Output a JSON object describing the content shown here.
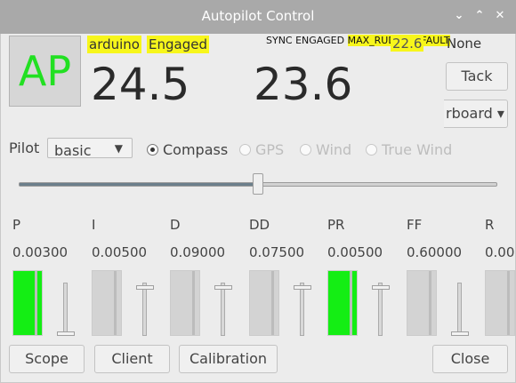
{
  "window": {
    "title": "Autopilot Control",
    "controls": [
      "⌄",
      "⌃",
      "✕"
    ]
  },
  "ap_button": {
    "label": "AP",
    "color": "#22e022"
  },
  "status": {
    "servo": "arduino",
    "mode_state": "Engaged",
    "flags_plain": "SYNC ENGAGED",
    "flags_fault": "MAX_RUDDER_FAULT",
    "rudder_partial": "22.6",
    "rudder_none": "None"
  },
  "heading": {
    "actual": "24.5",
    "command": "23.6"
  },
  "buttons": {
    "tack": "Tack",
    "tack_direction": "rboard ▾",
    "scope": "Scope",
    "client": "Client",
    "calibration": "Calibration",
    "close": "Close"
  },
  "pilot": {
    "label": "Pilot",
    "selected": "basic",
    "modes": [
      {
        "label": "Compass",
        "checked": true,
        "enabled": true
      },
      {
        "label": "GPS",
        "checked": false,
        "enabled": false
      },
      {
        "label": "Wind",
        "checked": false,
        "enabled": false
      },
      {
        "label": "True Wind",
        "checked": false,
        "enabled": false
      }
    ]
  },
  "command_slider": {
    "fraction": 0.5
  },
  "gains": [
    {
      "name": "P",
      "value": "0.00300",
      "level": 1.0,
      "slider": 0.02
    },
    {
      "name": "I",
      "value": "0.00500",
      "level": 0.0,
      "slider": 0.95
    },
    {
      "name": "D",
      "value": "0.09000",
      "level": 0.0,
      "slider": 0.95
    },
    {
      "name": "DD",
      "value": "0.07500",
      "level": 0.0,
      "slider": 0.95
    },
    {
      "name": "PR",
      "value": "0.00500",
      "level": 1.0,
      "slider": 0.95
    },
    {
      "name": "FF",
      "value": "0.60000",
      "level": 0.0,
      "slider": 0.02
    },
    {
      "name": "R",
      "value": "0.00",
      "level": 0.0,
      "slider": 0.95
    }
  ],
  "colors": {
    "highlight": "#f7f61b",
    "gain_fill": "#14ee14",
    "titlebar": "#a9a9a9"
  }
}
